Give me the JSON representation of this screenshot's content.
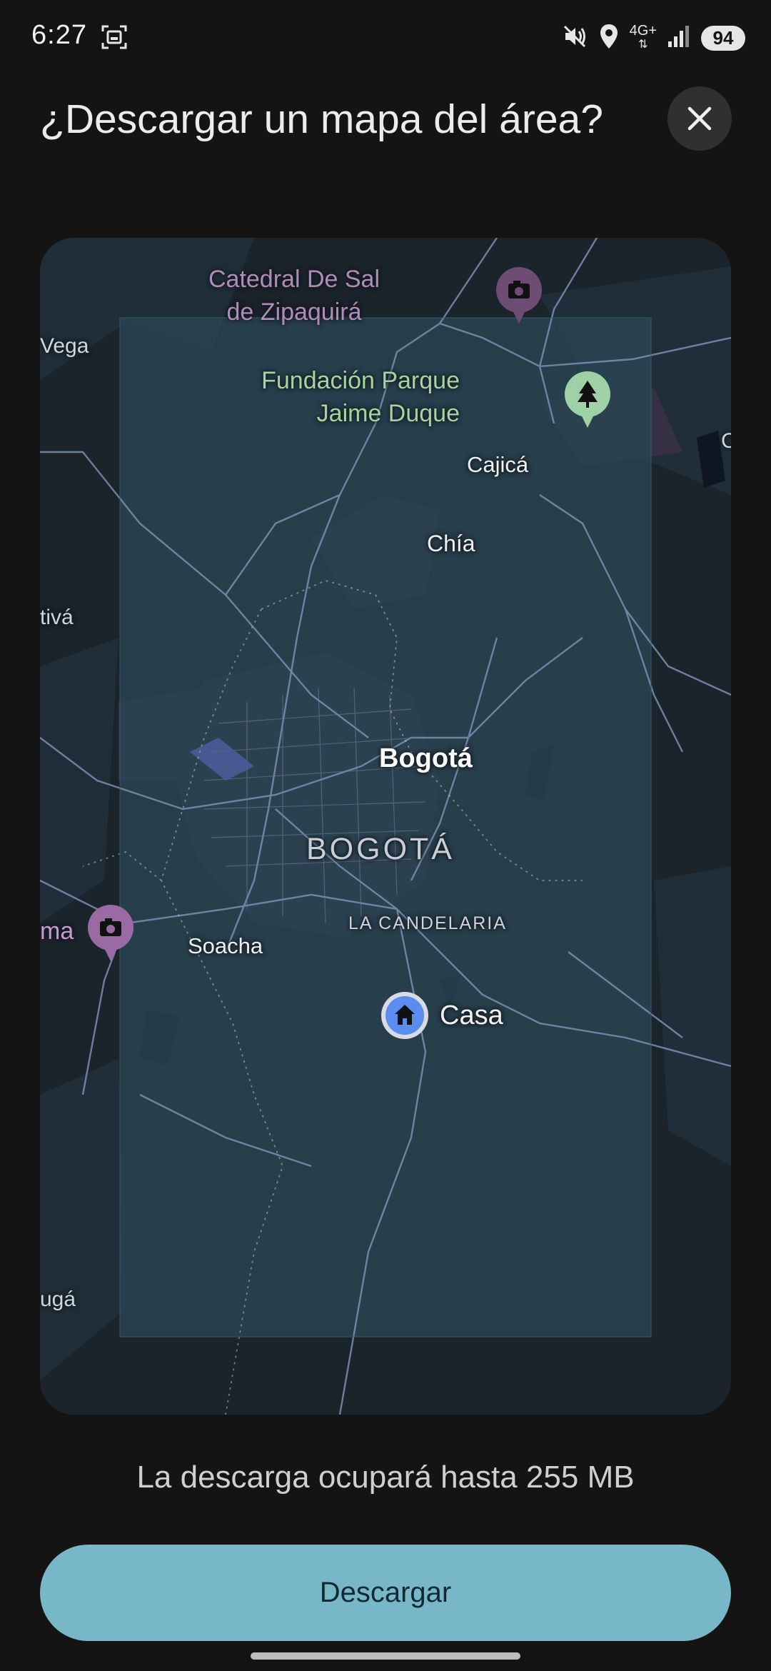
{
  "status_bar": {
    "time": "6:27",
    "network": "4G+",
    "battery": "94",
    "icons": [
      "screenshot-icon",
      "mute-icon",
      "location-icon",
      "signal-icon"
    ]
  },
  "header": {
    "title": "¿Descargar un mapa del área?",
    "close_icon": "close-icon"
  },
  "map": {
    "labels": {
      "catedral": "Catedral De Sal de Zipaquirá",
      "parque": "Fundación Parque Jaime Duque",
      "vega": "Vega",
      "cajica": "Cajicá",
      "chia": "Chía",
      "tiva": "tivá",
      "bogota_city": "Bogotá",
      "bogota_district": "BOGOTÁ",
      "candelaria": "LA CANDELARIA",
      "soacha": "Soacha",
      "ma": "ma",
      "casa": "Casa",
      "uga": "ugá",
      "edge_c": "C"
    },
    "markers": [
      "camera-marker-icon",
      "tree-marker-icon",
      "camera-marker-icon",
      "home-marker-icon"
    ]
  },
  "footer": {
    "size_note": "La descarga ocupará hasta 255 MB",
    "download_label": "Descargar"
  },
  "colors": {
    "background": "#141414",
    "accent": "#78b7c7",
    "selection": "#253e4d",
    "home_marker": "#5b8def"
  }
}
